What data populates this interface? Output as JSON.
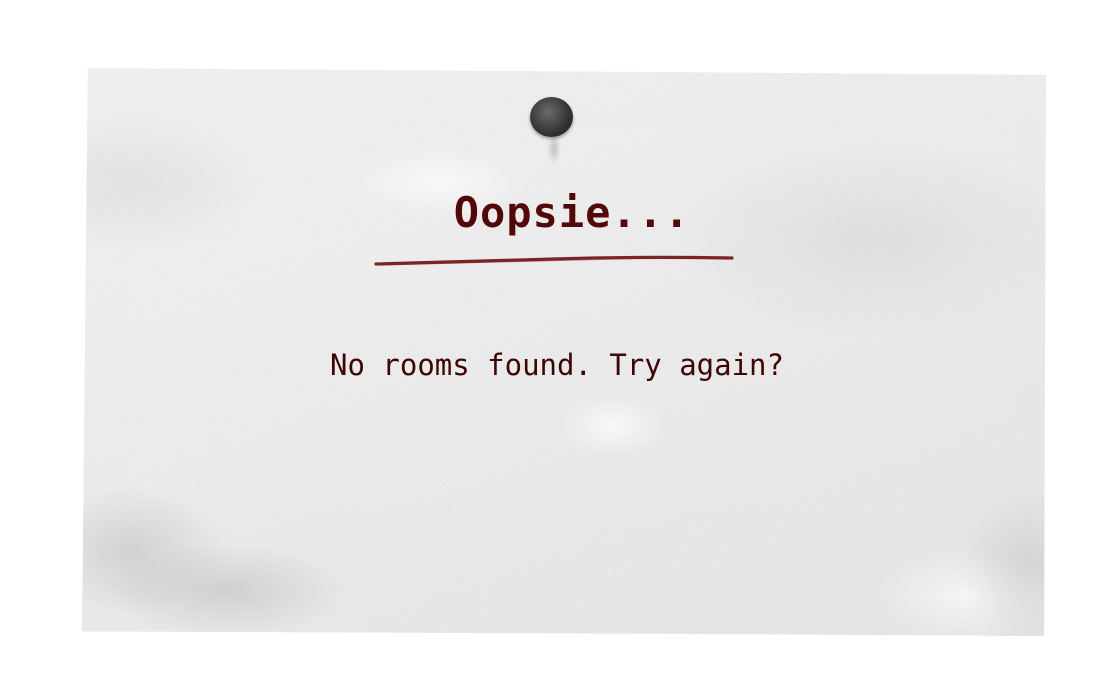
{
  "note": {
    "title": "Oopsie...",
    "message": "No rooms found. Try again?"
  },
  "colors": {
    "ink": "#520808",
    "underline": "#6e1010",
    "pin": "#3a3a3a",
    "paper": "#f0f0f0"
  },
  "icons": {
    "pin": "push-pin-icon"
  }
}
